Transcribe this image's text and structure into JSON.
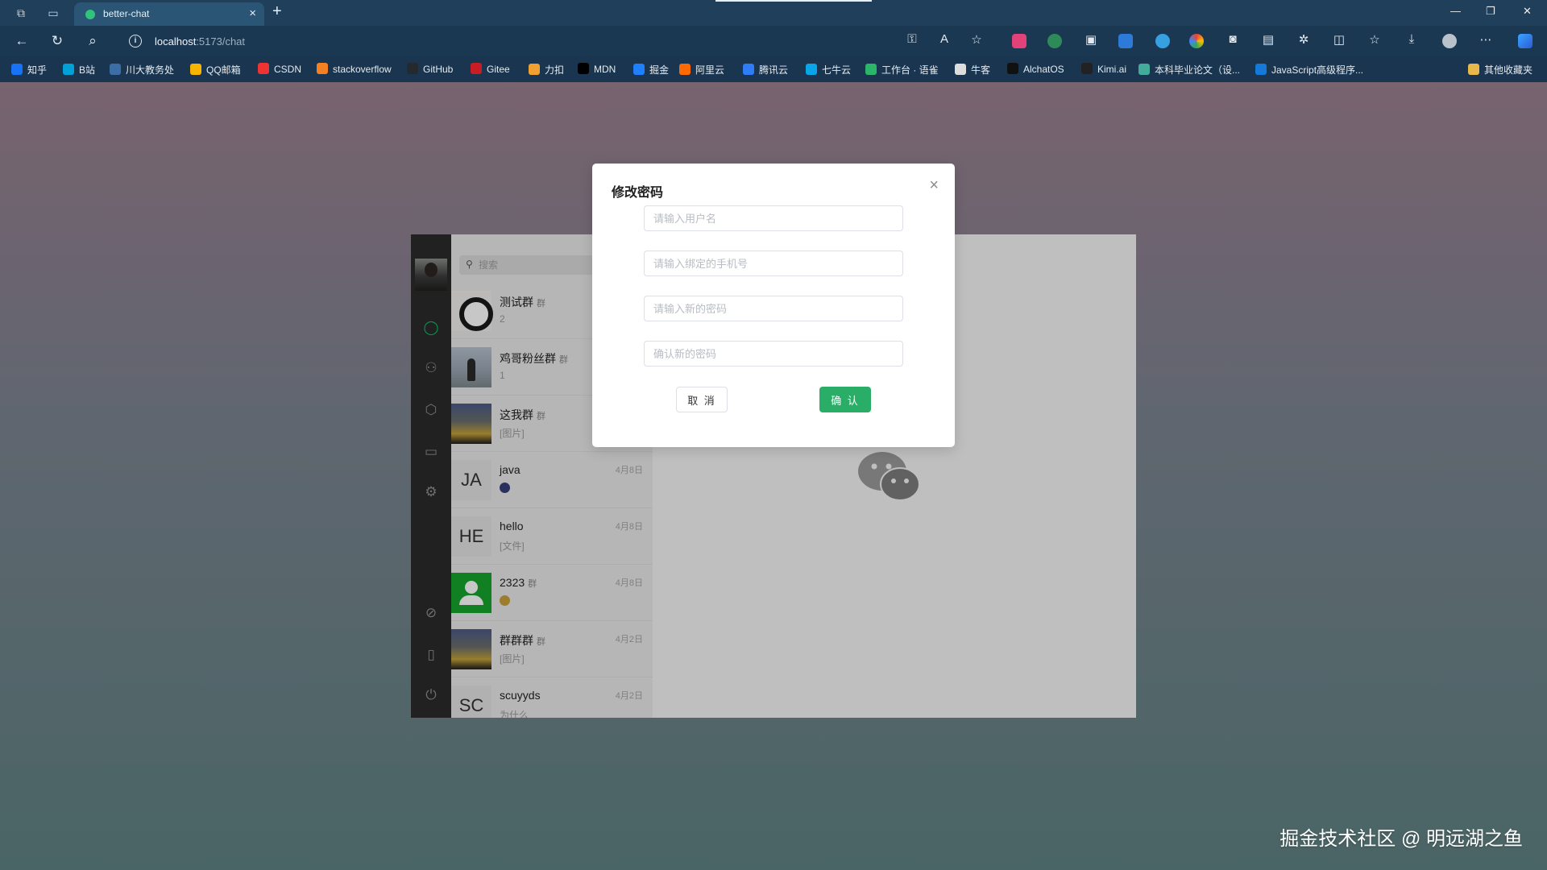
{
  "browser": {
    "tab_title": "better-chat",
    "tab_close": "×",
    "new_tab": "+",
    "url_host": "localhost",
    "url_path": ":5173/chat",
    "bookmarks": [
      "知乎",
      "B站",
      "川大教务处",
      "QQ邮箱",
      "CSDN",
      "stackoverflow",
      "GitHub",
      "Gitee",
      "力扣",
      "MDN",
      "掘金",
      "阿里云",
      "腾讯云",
      "七牛云",
      "工作台 · 语雀",
      "牛客",
      "AlchatOS",
      "Kimi.ai",
      "本科毕业论文（设...",
      "JavaScript高级程序...",
      "其他收藏夹"
    ]
  },
  "sidebar": {
    "search_placeholder": "搜索"
  },
  "chats": [
    {
      "name": "测试群",
      "group": true,
      "msg": "2",
      "time": ""
    },
    {
      "name": "鸡哥粉丝群",
      "group": true,
      "msg": "1",
      "time": ""
    },
    {
      "name": "这我群",
      "group": true,
      "msg": "[图片]",
      "time": ""
    },
    {
      "name": "java",
      "group": false,
      "initials": "JA",
      "msg": "",
      "time": "4月8日"
    },
    {
      "name": "hello",
      "group": false,
      "initials": "HE",
      "msg": "[文件]",
      "time": "4月8日"
    },
    {
      "name": "2323",
      "group": true,
      "msg": "",
      "time": "4月8日"
    },
    {
      "name": "群群群",
      "group": true,
      "msg": "[图片]",
      "time": "4月2日"
    },
    {
      "name": "scuyyds",
      "group": false,
      "initials": "SC",
      "msg": "为什么",
      "time": "4月2日"
    }
  ],
  "group_tag": "群",
  "modal": {
    "title": "修改密码",
    "close": "×",
    "username_placeholder": "请输入用户名",
    "phone_placeholder": "请输入绑定的手机号",
    "new_password_placeholder": "请输入新的密码",
    "confirm_password_placeholder": "确认新的密码",
    "cancel_label": "取 消",
    "confirm_label": "确 认"
  },
  "watermark": "掘金技术社区 @ 明远湖之鱼",
  "colors": {
    "accent": "#2aae67",
    "active_icon": "#07c160"
  }
}
